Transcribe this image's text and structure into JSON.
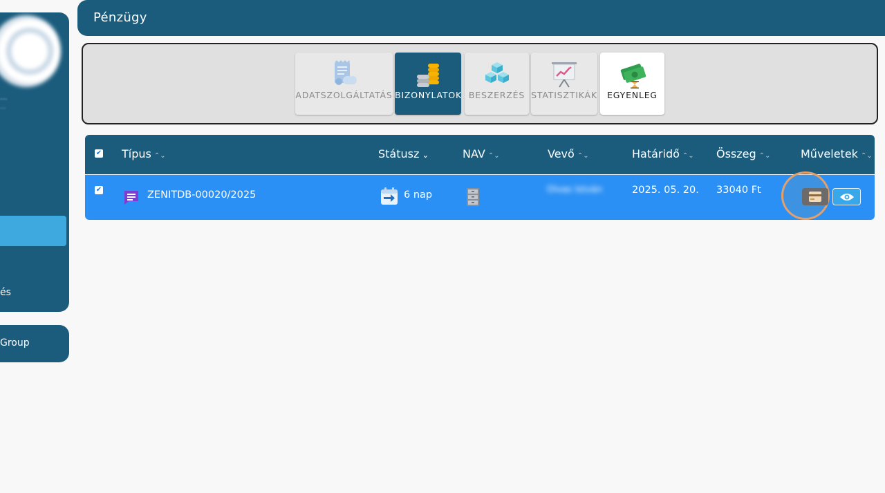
{
  "sidebar": {
    "logo_caption": "...",
    "logo_caption_2": "...",
    "item_es": "és",
    "group_label": "Group"
  },
  "header": {
    "title": "Pénzügy"
  },
  "tabs": [
    {
      "label": "ADATSZOLGÁLTATÁS",
      "icon": "receipt-icon",
      "active": false
    },
    {
      "label": "BIZONYLATOK",
      "icon": "coins-icon",
      "active": true
    },
    {
      "label": "BESZERZÉS",
      "icon": "cubes-icon",
      "active": false
    },
    {
      "label": "STATISZTIKÁK",
      "icon": "presentation-chart-icon",
      "active": false
    },
    {
      "label": "EGYENLEG",
      "icon": "money-hourglass-icon",
      "active": false
    }
  ],
  "table": {
    "columns": {
      "tipus": "Típus",
      "statusz": "Státusz",
      "nav": "NAV",
      "vevo": "Vevő",
      "hatarido": "Határidő",
      "osszeg": "Összeg",
      "muveletek": "Műveletek"
    },
    "sort_glyph": "⌃⌄",
    "status_dropdown_glyph": "⌄",
    "rows": [
      {
        "checked": true,
        "number": "ZENITDB-00020/2025",
        "status": "6 nap",
        "customer": "Olvas István",
        "deadline": "2025. 05. 20.",
        "amount": "33040 Ft"
      }
    ]
  },
  "colors": {
    "primary": "#1b5c7d",
    "accent": "#3da9df",
    "row_selected": "#2b90f5",
    "background": "#f8f8f8"
  }
}
